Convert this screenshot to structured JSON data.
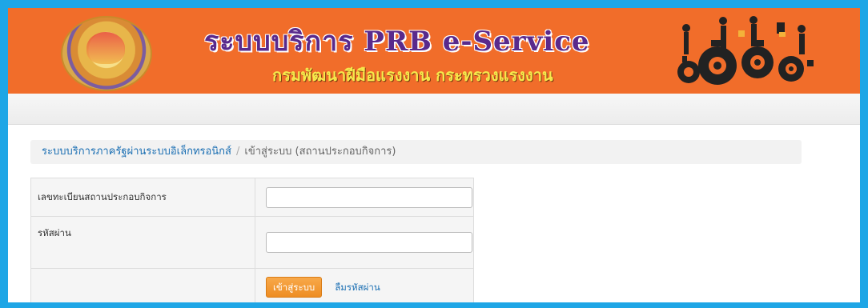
{
  "header": {
    "title": "ระบบบริการ PRB e-Service",
    "subtitle": "กรมพัฒนาฝีมือแรงงาน กระทรวงแรงงาน"
  },
  "breadcrumb": {
    "link_label": "ระบบบริการภาครัฐผ่านระบบอิเล็กทรอนิกส์",
    "separator": "/",
    "current_label": "เข้าสู่ระบบ (สถานประกอบกิจการ)"
  },
  "login_form": {
    "company_id_label": "เลขทะเบียนสถานประกอบกิจการ",
    "company_id_value": "",
    "password_label": "รหัสผ่าน",
    "password_value": "",
    "submit_label": "เข้าสู่ระบบ",
    "forgot_label": "ลืมรหัสผ่าน"
  },
  "colors": {
    "banner": "#f16d2a",
    "title": "#5a2a8c",
    "subtitle": "#f6e84b",
    "link": "#1b6fb3",
    "button": "#ee8d23",
    "border": "#1ea6e6"
  },
  "icons": {
    "logo": "department-seal-logo",
    "banner_art": "gears-workers-icon"
  }
}
